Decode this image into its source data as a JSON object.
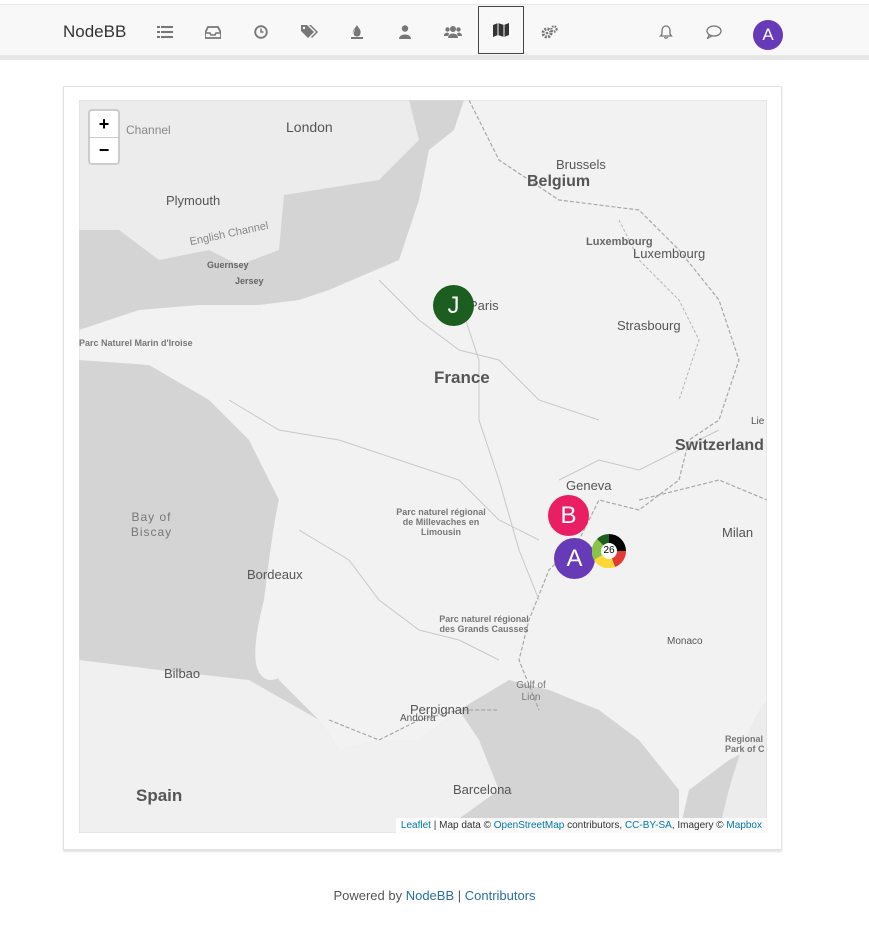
{
  "nav": {
    "brand": "NodeBB",
    "icons": [
      "list-icon",
      "inbox-icon",
      "clock-icon",
      "tags-icon",
      "fire-icon",
      "user-icon",
      "users-icon",
      "map-icon",
      "cogs-icon"
    ],
    "active_icon": "map-icon",
    "user_initial": "A",
    "accent": "#673ab7"
  },
  "map": {
    "zoom_in": "+",
    "zoom_out": "−",
    "labels": {
      "london": "London",
      "brussels": "Brussels",
      "belgium": "Belgium",
      "plymouth": "Plymouth",
      "english_channel": "English Channel",
      "channel_top": "Channel",
      "guernsey": "Guernsey",
      "jersey": "Jersey",
      "luxembourg1": "Luxembourg",
      "luxembourg2": "Luxembourg",
      "paris": "Paris",
      "strasbourg": "Strasbourg",
      "parc_iroise": "Parc Naturel Marin d'Iroise",
      "france": "France",
      "switzerland": "Switzerland",
      "geneva": "Geneva",
      "bay_of_biscay": "Bay of Biscay",
      "millevaches": "Parc naturel régional de Millevaches en Limousin",
      "bordeaux": "Bordeaux",
      "milan": "Milan",
      "grands_causses": "Parc naturel régional des Grands Causses",
      "monaco": "Monaco",
      "bilbao": "Bilbao",
      "gulf_of_lion": "Gulf of Lion",
      "perpignan": "Perpignan",
      "andorra": "Andorra",
      "regional_park": "Regional Park of C",
      "spain": "Spain",
      "barcelona": "Barcelona",
      "lie": "Lie"
    },
    "markers": [
      {
        "initial": "J",
        "color": "#1b5e20"
      },
      {
        "initial": "B",
        "color": "#e91e63"
      },
      {
        "initial": "A",
        "color": "#673ab7"
      }
    ],
    "cluster": {
      "count": "26",
      "colors": [
        "#000000",
        "#e53935",
        "#fdd835",
        "#8bc34a",
        "#1b5e20"
      ]
    },
    "attribution": {
      "leaflet": "Leaflet",
      "sep": " | Map data © ",
      "osm": "OpenStreetMap",
      "contributors": " contributors, ",
      "license": "CC-BY-SA",
      "imagery": ", Imagery © ",
      "mapbox": "Mapbox"
    }
  },
  "footer": {
    "prefix": "Powered by ",
    "nodebb": "NodeBB",
    "pipe": " | ",
    "contributors": "Contributors"
  }
}
